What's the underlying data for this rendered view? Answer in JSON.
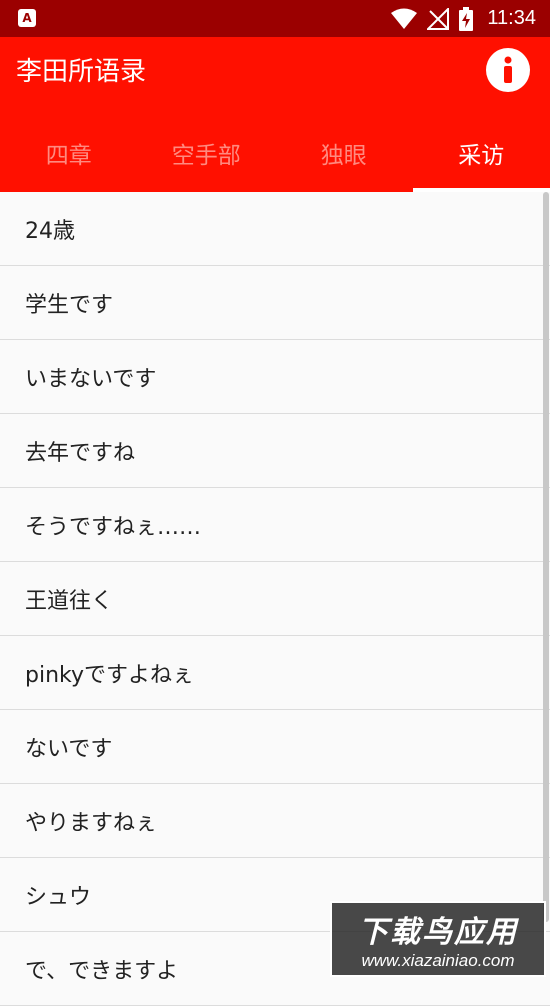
{
  "status_bar": {
    "time": "11:34",
    "icons": [
      "app-notification-icon",
      "wifi-icon",
      "no-signal-icon",
      "battery-charging-icon"
    ],
    "app_icon_letter": "A"
  },
  "app_bar": {
    "title": "李田所语录",
    "info_icon": "info-icon",
    "background_color": "#ff1000"
  },
  "tabs": [
    {
      "label": "四章",
      "active": false
    },
    {
      "label": "空手部",
      "active": false
    },
    {
      "label": "独眼",
      "active": false
    },
    {
      "label": "采访",
      "active": true
    }
  ],
  "list": {
    "items": [
      "24歳",
      "学生です",
      "いまないです",
      "去年ですね",
      "そうですねぇ……",
      "王道往く",
      "pinkyですよねぇ",
      "ないです",
      "やりますねぇ",
      "シュウ",
      "で、できますよ"
    ]
  },
  "watermark": {
    "title": "下载鸟应用",
    "url": "www.xiazainiao.com"
  }
}
